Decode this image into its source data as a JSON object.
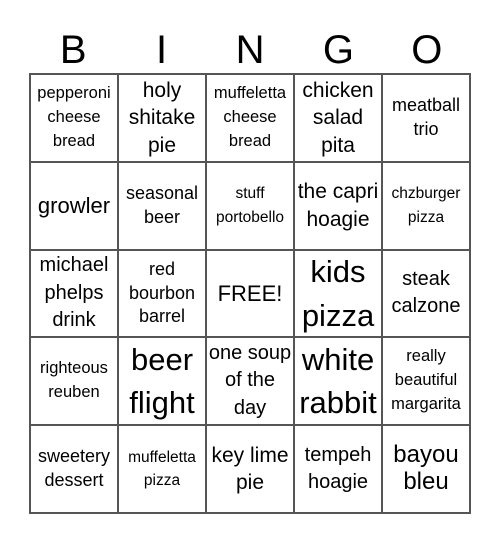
{
  "title_letters": [
    "B",
    "I",
    "N",
    "G",
    "O"
  ],
  "cells": [
    [
      "pepperoni cheese bread",
      "holy shitake pie",
      "muffeletta cheese bread",
      "chicken salad pita",
      "meatball trio"
    ],
    [
      "growler",
      "seasonal beer",
      "stuff portobello",
      "the capri hoagie",
      "chzburger pizza"
    ],
    [
      "michael phelps drink",
      "red bourbon barrel",
      "FREE!",
      "kids pizza",
      "steak calzone"
    ],
    [
      "righteous reuben",
      "beer flight",
      "one soup of the day",
      "white rabbit",
      "really beautiful margarita"
    ],
    [
      "sweetery dessert",
      "muffeletta pizza",
      "key lime pie",
      "tempeh hoagie",
      "bayou bleu"
    ]
  ]
}
